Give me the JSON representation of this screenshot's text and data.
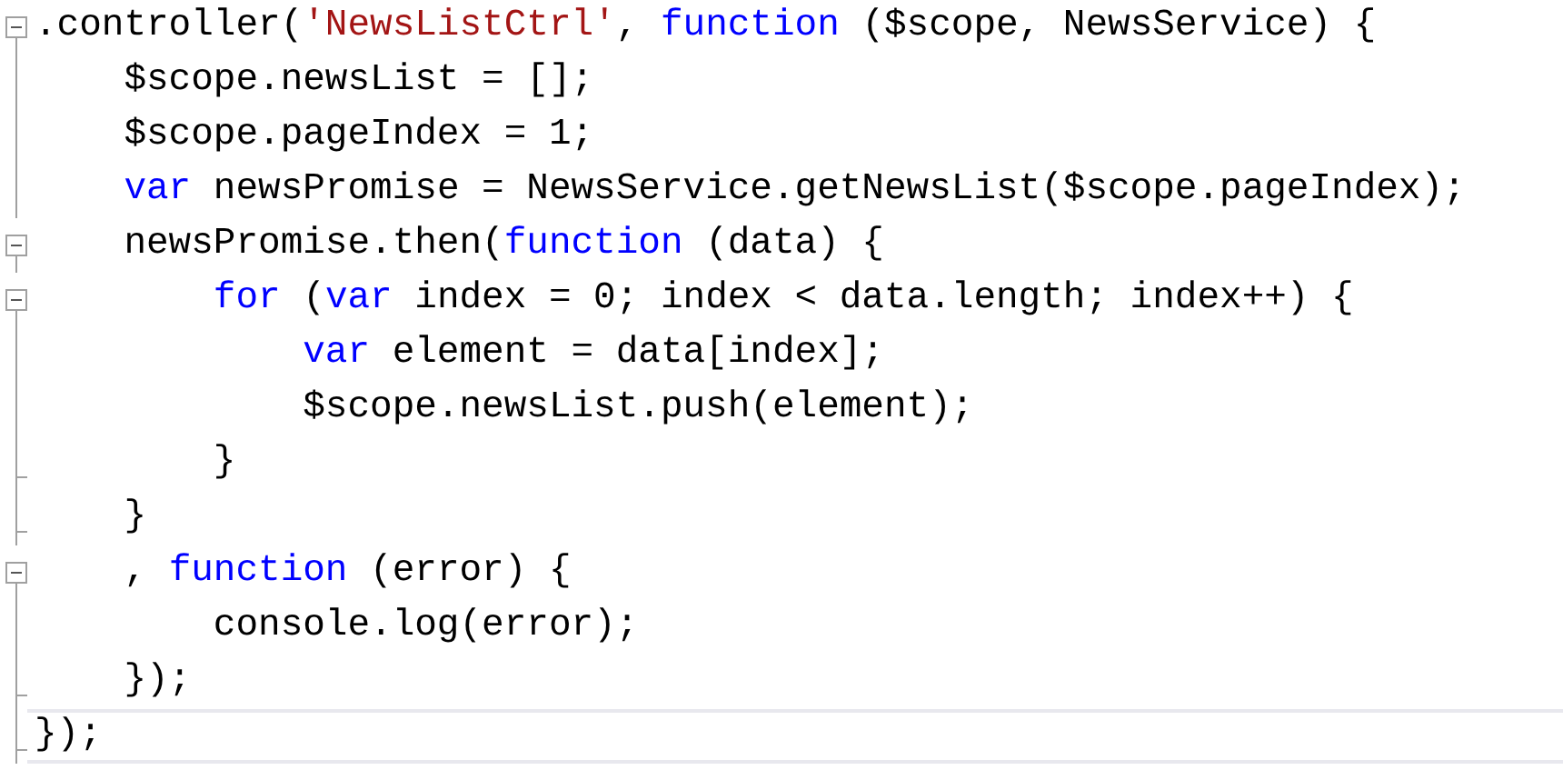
{
  "editor": {
    "lines": [
      {
        "kind": "fold",
        "current": false,
        "tokens": [
          {
            "kind": "plain",
            "text": ".controller("
          },
          {
            "kind": "string",
            "text": "'NewsListCtrl'"
          },
          {
            "kind": "plain",
            "text": ", "
          },
          {
            "kind": "keyword",
            "text": "function"
          },
          {
            "kind": "plain",
            "text": " ($scope, NewsService) {"
          }
        ]
      },
      {
        "kind": "bar",
        "current": false,
        "tokens": [
          {
            "kind": "plain",
            "text": "    $scope.newsList = [];"
          }
        ]
      },
      {
        "kind": "bar",
        "current": false,
        "tokens": [
          {
            "kind": "plain",
            "text": "    $scope.pageIndex = 1;"
          }
        ]
      },
      {
        "kind": "bar",
        "current": false,
        "tokens": [
          {
            "kind": "keyword",
            "text": "    var"
          },
          {
            "kind": "plain",
            "text": " newsPromise = NewsService.getNewsList($scope.pageIndex);"
          }
        ]
      },
      {
        "kind": "fold",
        "current": false,
        "tokens": [
          {
            "kind": "plain",
            "text": "    newsPromise.then("
          },
          {
            "kind": "keyword",
            "text": "function"
          },
          {
            "kind": "plain",
            "text": " (data) {"
          }
        ]
      },
      {
        "kind": "fold",
        "current": false,
        "tokens": [
          {
            "kind": "keyword",
            "text": "        for"
          },
          {
            "kind": "plain",
            "text": " ("
          },
          {
            "kind": "keyword",
            "text": "var"
          },
          {
            "kind": "plain",
            "text": " index = 0; index < data.length; index++) {"
          }
        ]
      },
      {
        "kind": "bar",
        "current": false,
        "tokens": [
          {
            "kind": "keyword",
            "text": "            var"
          },
          {
            "kind": "plain",
            "text": " element = data[index];"
          }
        ]
      },
      {
        "kind": "bar",
        "current": false,
        "tokens": [
          {
            "kind": "plain",
            "text": "            $scope.newsList.push(element);"
          }
        ]
      },
      {
        "kind": "end",
        "current": false,
        "tokens": [
          {
            "kind": "plain",
            "text": "        }"
          }
        ]
      },
      {
        "kind": "end",
        "current": false,
        "tokens": [
          {
            "kind": "plain",
            "text": "    }"
          }
        ]
      },
      {
        "kind": "fold",
        "current": false,
        "tokens": [
          {
            "kind": "plain",
            "text": "    , "
          },
          {
            "kind": "keyword",
            "text": "function"
          },
          {
            "kind": "plain",
            "text": " (error) {"
          }
        ]
      },
      {
        "kind": "bar",
        "current": false,
        "tokens": [
          {
            "kind": "plain",
            "text": "        console.log(error);"
          }
        ]
      },
      {
        "kind": "end",
        "current": false,
        "tokens": [
          {
            "kind": "plain",
            "text": "    });"
          }
        ]
      },
      {
        "kind": "end",
        "current": true,
        "tokens": [
          {
            "kind": "plain",
            "text": "});"
          }
        ]
      }
    ]
  }
}
